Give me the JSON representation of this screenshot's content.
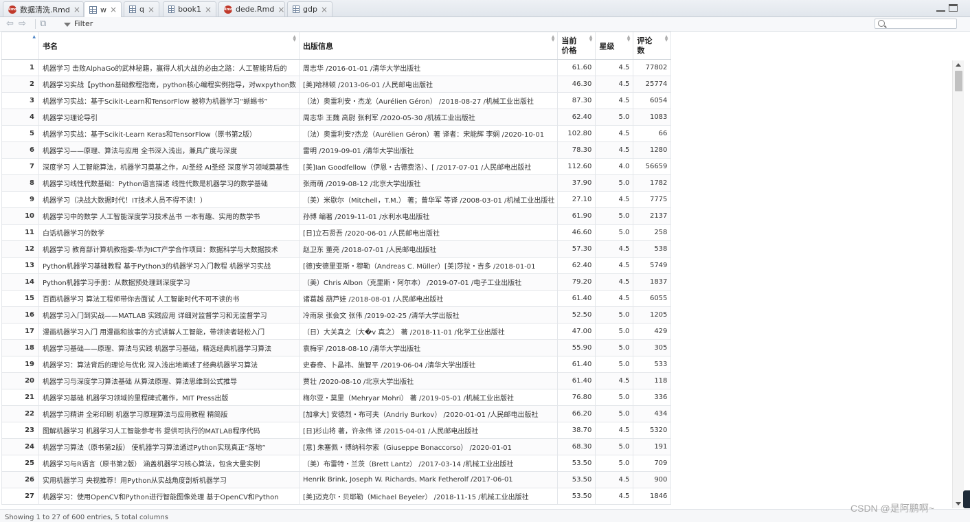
{
  "tabs": [
    {
      "label": "数据清洗.Rmd",
      "icon": "rmd-file-icon",
      "active": false
    },
    {
      "label": "w",
      "icon": "data-grid-icon",
      "active": true
    },
    {
      "label": "q",
      "icon": "data-grid-icon",
      "active": false
    },
    {
      "label": "book1",
      "icon": "data-grid-icon",
      "active": false
    },
    {
      "label": "dede.Rmd",
      "icon": "rmd-file-icon",
      "active": false
    },
    {
      "label": "gdp",
      "icon": "data-grid-icon",
      "active": false
    }
  ],
  "tab_close_glyph": "×",
  "rmd_icon_text": "Rmd",
  "toolbar": {
    "filter_label": "Filter",
    "back_glyph": "⇦",
    "forward_glyph": "⇨",
    "popout_glyph": "⧉",
    "search_value": ""
  },
  "columns": [
    "书名",
    "出版信息",
    "当前价格",
    "星级",
    "评论数"
  ],
  "rows": [
    [
      "1",
      "机器学习 击败AlphaGo的武林秘籍，赢得人机大战的必由之路：人工智能背后的",
      "周志华 /2016-01-01 /清华大学出版社",
      "61.60",
      "4.5",
      "77802"
    ],
    [
      "2",
      "机器学习实战【python基础教程指南，python核心编程实例指导，对wxpython数",
      "[美]哈林顿 /2013-06-01 /人民邮电出版社",
      "46.30",
      "4.5",
      "25774"
    ],
    [
      "3",
      "机器学习实战：基于Scikit-Learn和TensorFlow 被称为机器学习“蜥蜴书”",
      "（法）奥雷利安・杰龙（Aurélien Géron） /2018-08-27 /机械工业出版社",
      "87.30",
      "4.5",
      "6054"
    ],
    [
      "4",
      "机器学习理论导引",
      "周志华 王魏 高尉 张利军 /2020-05-30 /机械工业出版社",
      "62.40",
      "5.0",
      "1083"
    ],
    [
      "5",
      "机器学习实战：基于Scikit-Learn Keras和TensorFlow（原书第2版）",
      "（法）奥雷利安?杰龙（Aurélien Géron）著 译者：宋能辉 李娴 /2020-10-01",
      "102.80",
      "4.5",
      "66"
    ],
    [
      "6",
      "机器学习——原理、算法与应用 全书深入浅出，兼具广度与深度",
      "雷明 /2019-09-01 /清华大学出版社",
      "78.30",
      "4.5",
      "1280"
    ],
    [
      "7",
      "深度学习 人工智能算法，机器学习奠基之作，AI圣经 AI圣经 深度学习领域奠基性",
      "[美]Ian Goodfellow（伊恩・古德费洛）、[ /2017-07-01 /人民邮电出版社",
      "112.60",
      "4.0",
      "56659"
    ],
    [
      "8",
      "机器学习线性代数基础：Python语言描述 线性代数是机器学习的数学基础",
      "张雨萌 /2019-08-12 /北京大学出版社",
      "37.90",
      "5.0",
      "1782"
    ],
    [
      "9",
      "机器学习（决战大数据时代！IT技术人员不得不读！）",
      "（美）米歇尔（Mitchell，T.M.） 著；曾华军 等译 /2008-03-01 /机械工业出版社",
      "27.10",
      "4.5",
      "7775"
    ],
    [
      "10",
      "机器学习中的数学 人工智能深度学习技术丛书 一本有趣、实用的数学书",
      "孙博 编著 /2019-11-01 /水利水电出版社",
      "61.90",
      "5.0",
      "2137"
    ],
    [
      "11",
      "白话机器学习的数学",
      "[日]立石贤吾 /2020-06-01 /人民邮电出版社",
      "46.60",
      "5.0",
      "258"
    ],
    [
      "12",
      "机器学习 教育部计算机教指委-华为ICT产学合作项目：数据科学与大数据技术",
      "赵卫东 董亮 /2018-07-01 /人民邮电出版社",
      "57.30",
      "4.5",
      "538"
    ],
    [
      "13",
      "Python机器学习基础教程 基于Python3的机器学习入门教程 机器学习实战",
      "[德]安德里亚斯・穆勒（Andreas C. Müller）[美]莎拉・吉多 /2018-01-01",
      "62.40",
      "4.5",
      "5749"
    ],
    [
      "14",
      "Python机器学习手册：从数据预处理到深度学习",
      "（美）Chris Albon（克里斯・阿尔本） /2019-07-01 /电子工业出版社",
      "79.20",
      "4.5",
      "1837"
    ],
    [
      "15",
      "百面机器学习 算法工程师带你去面试 人工智能时代不可不读的书",
      "诸葛越 葫芦娃 /2018-08-01 /人民邮电出版社",
      "61.40",
      "4.5",
      "6055"
    ],
    [
      "16",
      "机器学习入门到实战——MATLAB 实践应用 详细对监督学习和无监督学习",
      "冷雨泉 张会文 张伟 /2019-02-25 /清华大学出版社",
      "52.50",
      "5.0",
      "1205"
    ],
    [
      "17",
      "漫画机器学习入门 用漫画和故事的方式讲解人工智能，带领读者轻松入门",
      "（日）大关真之（大�v 真之） 著 /2018-11-01 /化学工业出版社",
      "47.00",
      "5.0",
      "429"
    ],
    [
      "18",
      "机器学习基础——原理、算法与实践 机器学习基础，精选经典机器学习算法",
      "袁梅宇 /2018-08-10 /清华大学出版社",
      "55.90",
      "5.0",
      "305"
    ],
    [
      "19",
      "机器学习：算法背后的理论与优化 深入浅出地阐述了经典机器学习算法",
      "史春奇、卜晶祎、施智平 /2019-06-04 /清华大学出版社",
      "61.40",
      "5.0",
      "533"
    ],
    [
      "20",
      "机器学习与深度学习算法基础 从算法原理、算法思维到公式推导",
      "贾壮 /2020-08-10 /北京大学出版社",
      "61.40",
      "4.5",
      "118"
    ],
    [
      "21",
      "机器学习基础 机器学习领域的里程碑式著作，MIT Press出版",
      "梅尔亚・莫里（Mehryar Mohri） 著 /2019-05-01 /机械工业出版社",
      "76.80",
      "5.0",
      "336"
    ],
    [
      "22",
      "机器学习精讲 全彩印刷 机器学习原理算法与应用教程 精简版",
      "[加拿大] 安德烈・布可夫（Andriy Burkov） /2020-01-01 /人民邮电出版社",
      "66.20",
      "5.0",
      "434"
    ],
    [
      "23",
      "图解机器学习 机器学习人工智能参考书 提供可执行的MATLAB程序代码",
      "[日]杉山将 著，许永伟 译 /2015-04-01 /人民邮电出版社",
      "38.70",
      "4.5",
      "5320"
    ],
    [
      "24",
      "机器学习算法（原书第2版） 使机器学习算法通过Python实现真正“落地”",
      "[意] 朱塞佩・博纳科尔索（Giuseppe Bonaccorso） /2020-01-01",
      "68.30",
      "5.0",
      "191"
    ],
    [
      "25",
      "机器学习与R语言（原书第2版） 涵盖机器学习核心算法，包含大量实例",
      "（美）布雷特・兰茨（Brett Lantz） /2017-03-14 /机械工业出版社",
      "53.50",
      "5.0",
      "709"
    ],
    [
      "26",
      "实用机器学习 央视推荐！用Python从实战角度剖析机器学习",
      "Henrik Brink, Joseph W. Richards, Mark Fetherolf /2017-06-01",
      "53.50",
      "4.5",
      "900"
    ],
    [
      "27",
      "机器学习：使用OpenCV和Python进行智能图像处理 基于OpenCV和Python",
      "[美]迈克尔・贝耶勒（Michael Beyeler） /2018-11-15 /机械工业出版社",
      "53.50",
      "4.5",
      "1846"
    ]
  ],
  "status_text": "Showing 1 to 27 of 600 entries, 5 total columns",
  "watermark": "CSDN @是阿鹏啊~"
}
